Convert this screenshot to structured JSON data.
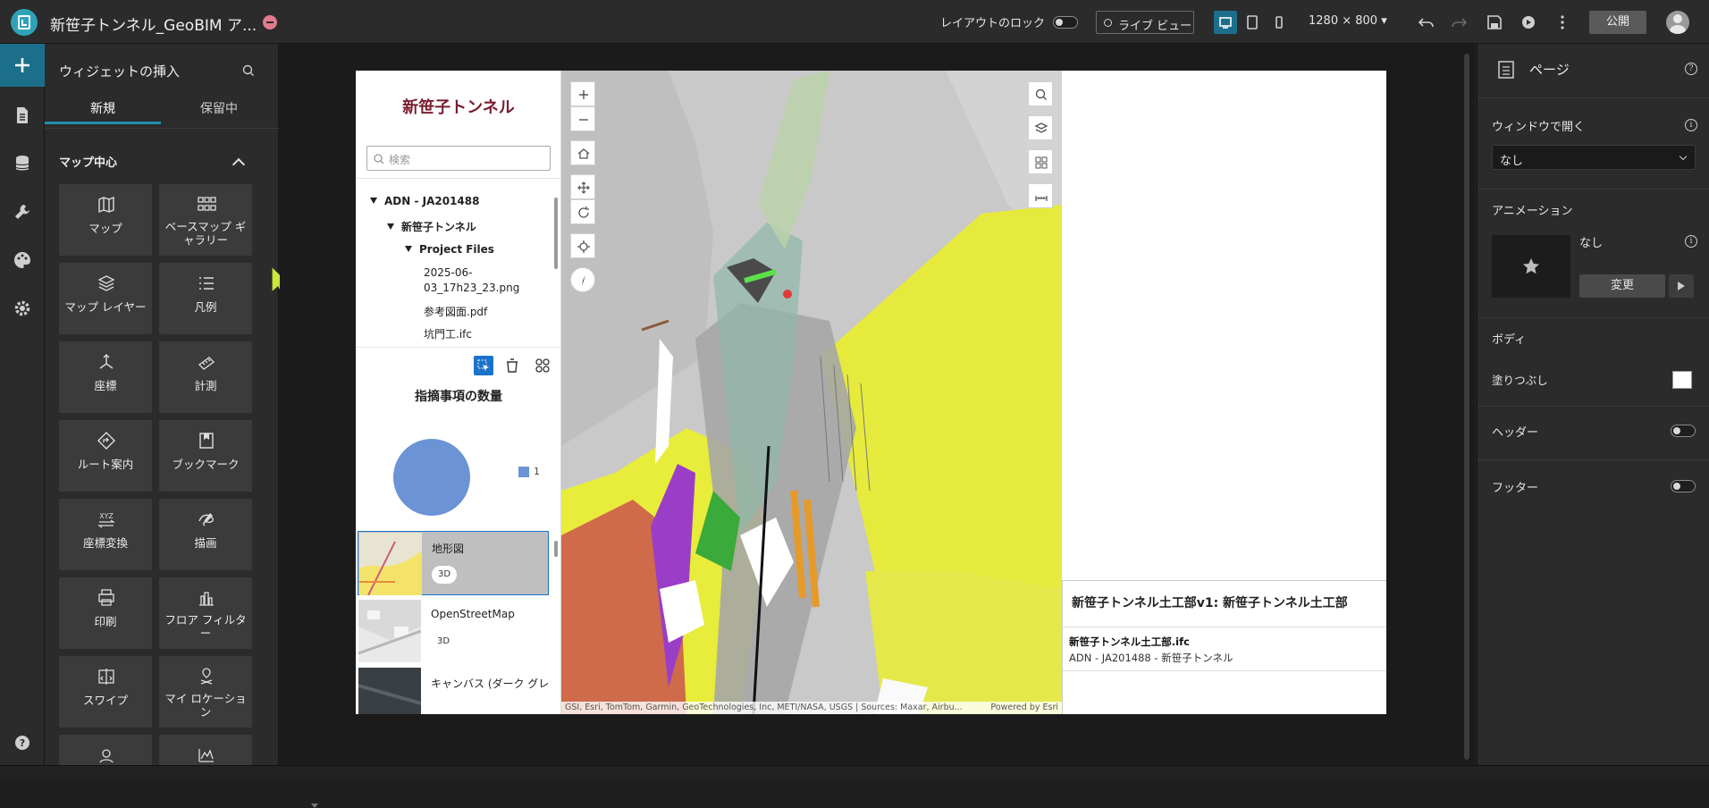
{
  "header": {
    "title": "新笹子トンネル_GeoBIM ア...",
    "layout_lock_label": "レイアウトのロック",
    "live_view_label": "ライブ ビュー",
    "resolution": "1280 × 800",
    "publish_label": "公開"
  },
  "widget_panel": {
    "title": "ウィジェットの挿入",
    "tabs": {
      "new": "新規",
      "pending": "保留中"
    },
    "section": "マップ中心",
    "widgets": [
      {
        "label": "マップ",
        "icon": "map-icon"
      },
      {
        "label": "ベースマップ ギャラリー",
        "icon": "basemap-gallery-icon"
      },
      {
        "label": "マップ レイヤー",
        "icon": "layers-icon"
      },
      {
        "label": "凡例",
        "icon": "legend-icon"
      },
      {
        "label": "座標",
        "icon": "coordinates-icon"
      },
      {
        "label": "計測",
        "icon": "measure-icon"
      },
      {
        "label": "ルート案内",
        "icon": "directions-icon"
      },
      {
        "label": "ブックマーク",
        "icon": "bookmark-icon"
      },
      {
        "label": "座標変換",
        "icon": "coordinate-conversion-icon"
      },
      {
        "label": "描画",
        "icon": "draw-icon"
      },
      {
        "label": "印刷",
        "icon": "print-icon"
      },
      {
        "label": "フロア フィルター",
        "icon": "floor-filter-icon"
      },
      {
        "label": "スワイプ",
        "icon": "swipe-icon"
      },
      {
        "label": "マイ ロケーション",
        "icon": "my-location-icon"
      },
      {
        "label": "",
        "icon": "near-me-icon"
      },
      {
        "label": "",
        "icon": "elevation-profile-icon"
      }
    ]
  },
  "app_page": {
    "app_name": "新笹子トンネル",
    "search_placeholder": "検索",
    "tree": {
      "root": "ADN - JA201488",
      "project": "新笹子トンネル",
      "folder": "Project Files",
      "file1_line1": "2025-06-",
      "file1_line2": "03_17h23_23.png",
      "file2": "参考図面.pdf",
      "file3": "坑門工.ifc"
    },
    "chart_title": "指摘事項の数量",
    "legend_value": "1",
    "bookmarks": [
      {
        "name": "地形図",
        "badge": "3D"
      },
      {
        "name": "OpenStreetMap",
        "badge": "3D"
      },
      {
        "name": "キャンバス (ダーク グレ",
        "badge": ""
      }
    ],
    "attribution": "GSI, Esri, TomTom, Garmin, GeoTechnologies, Inc, METI/NASA, USGS | Sources: Maxar, Airbu...",
    "powered_by": "Powered by Esri",
    "feature_info": {
      "title": "新笹子トンネル土工部v1: 新笹子トンネル土工部",
      "file": "新笹子トンネル土工部.ifc",
      "path": "ADN - JA201488 - 新笹子トンネル"
    }
  },
  "chart_data": {
    "type": "pie",
    "title": "指摘事項の数量",
    "categories": [
      "1"
    ],
    "values": [
      1
    ],
    "colors": [
      "#6b93d6"
    ]
  },
  "right_panel": {
    "title": "ページ",
    "open_in_window_label": "ウィンドウで開く",
    "open_in_window_value": "なし",
    "animation_label": "アニメーション",
    "animation_value": "なし",
    "change_label": "変更",
    "body_label": "ボディ",
    "fill_label": "塗りつぶし",
    "header_label": "ヘッダー",
    "footer_label": "フッター"
  },
  "colors": {
    "accent": "#1c6f8a",
    "app_name": "#7a1e2e",
    "selection": "#1a73c9"
  }
}
